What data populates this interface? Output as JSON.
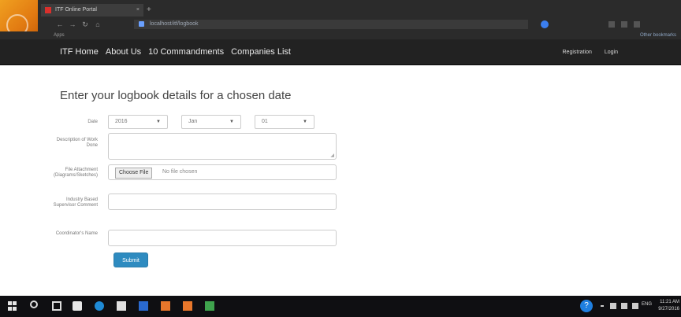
{
  "browser": {
    "tab_title": "ITF Online Portal",
    "url": "localhost/itf/logbook",
    "bookmark_text": "Apps",
    "bookmark_right": "Other bookmarks"
  },
  "navbar": {
    "links": [
      "ITF Home",
      "About Us",
      "10 Commandments",
      "Companies List"
    ],
    "right": [
      "Registration",
      "Login"
    ]
  },
  "form": {
    "heading": "Enter your logbook details for a chosen date",
    "date_label": "Date",
    "date_values": [
      "2016",
      "Jan",
      "01"
    ],
    "description_label": "Description of Work Done",
    "attachment_label": "File Attachment (Diagrams/Sketches)",
    "choose_file_label": "Choose File",
    "no_file_text": "No file chosen",
    "supervisor_comment_label": "Industry Based Supervisor Comment",
    "coordinator_label": "Coordinator's Name",
    "submit_label": "Submit"
  },
  "taskbar": {
    "time": "11:21 AM",
    "date": "9/27/2016",
    "lang": "ENG"
  }
}
